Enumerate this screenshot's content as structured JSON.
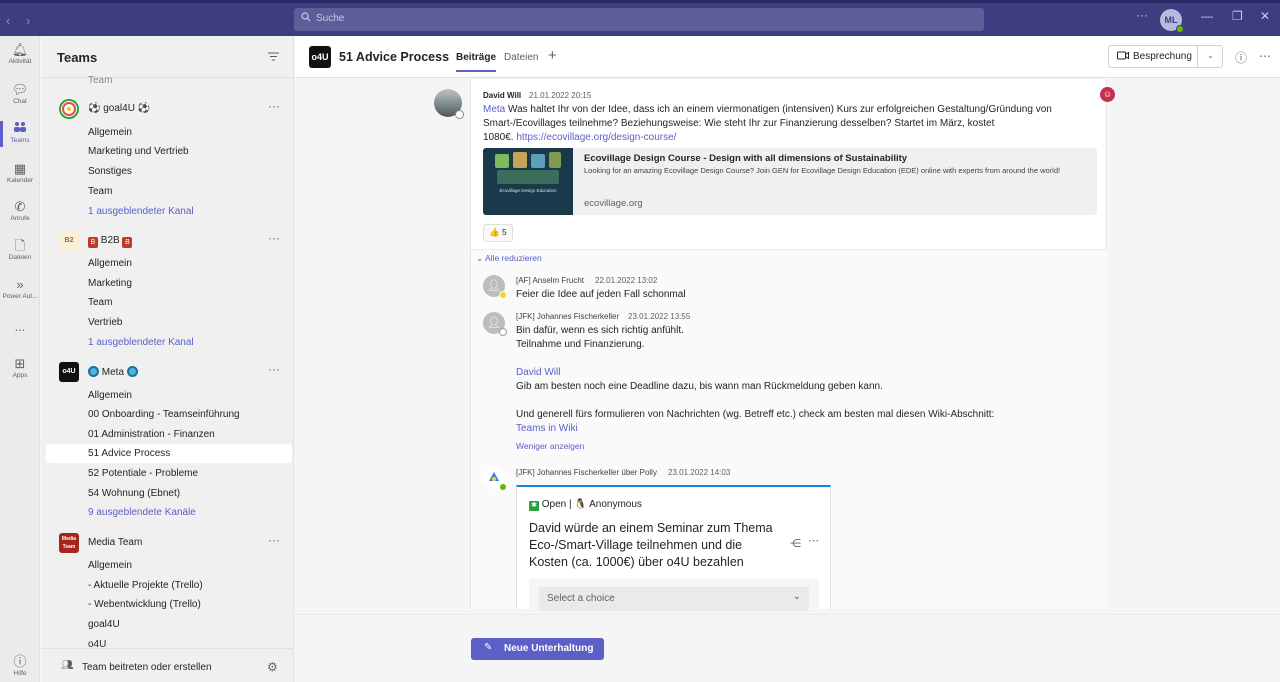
{
  "titlebar": {
    "search_placeholder": "Suche",
    "more": "···",
    "user_initials": "ML"
  },
  "rail": {
    "items": [
      {
        "icon": "bell-icon",
        "label": "Aktivität"
      },
      {
        "icon": "chat-icon",
        "label": "Chat"
      },
      {
        "icon": "teams-icon",
        "label": "Teams"
      },
      {
        "icon": "calendar-icon",
        "label": "Kalender"
      },
      {
        "icon": "phone-icon",
        "label": "Anrufe"
      },
      {
        "icon": "file-icon",
        "label": "Dateien"
      },
      {
        "icon": "power-automate-icon",
        "label": "Power Aut..."
      },
      {
        "icon": "more-icon",
        "label": "..."
      },
      {
        "icon": "apps-icon",
        "label": "Apps"
      },
      {
        "icon": "help-icon",
        "label": "Hilfe"
      }
    ]
  },
  "teams": {
    "header": "Teams",
    "partial_top": "Team",
    "groups": [
      {
        "name": "goal4U",
        "logo_text": "",
        "channels": [
          "Allgemein",
          "Marketing und Vertrieb",
          "Sonstiges",
          "Team"
        ],
        "hidden": "1 ausgeblendeter Kanal"
      },
      {
        "name": "B2B",
        "logo_text": "B2",
        "badge": "B",
        "channels": [
          "Allgemein",
          "Marketing",
          "Team",
          "Vertrieb"
        ],
        "hidden": "1 ausgeblendeter Kanal"
      },
      {
        "name": "Meta",
        "logo_text": "o4U",
        "channels": [
          "Allgemein",
          "00 Onboarding - Teamseinführung",
          "01 Administration - Finanzen",
          "51 Advice Process",
          "52 Potentiale - Probleme",
          "54 Wohnung (Ebnet)"
        ],
        "hidden": "9 ausgeblendete Kanäle"
      },
      {
        "name": "Media Team",
        "logo_text": "Media Team",
        "channels": [
          "Allgemein",
          "- Aktuelle Projekte (Trello)",
          "- Webentwicklung (Trello)",
          "goal4U",
          "o4U"
        ]
      }
    ],
    "more": "···",
    "footer": "Team beitreten oder erstellen"
  },
  "channel": {
    "logo_text": "o4U",
    "title": "51 Advice Process",
    "tabs": [
      "Beiträge",
      "Dateien"
    ],
    "add_tab": "+",
    "meeting_label": "Besprechung"
  },
  "post": {
    "author": "David Will",
    "time": "21.01.2022 20:15",
    "mention": "Meta",
    "text_line1": " Was haltet Ihr von der Idee, dass ich an einem viermonatigen (intensiven) Kurs zur erfolgreichen Gestaltung/Gründung von",
    "text_line2": "Smart-/Ecovillages teilnehme? Beziehungsweise: Wie steht Ihr zur Finanzierung desselben? Startet im März, kostet",
    "text_line3_pre": "1080€. ",
    "url": "https://ecovillage.org/design-course/",
    "link_card": {
      "title": "Ecovillage Design Course - Design with all dimensions of Sustainability",
      "description": "Looking for an amazing Ecovillage Design Course? Join GEN for Ecovillage Design Education (EDE) online with experts from around the world!",
      "domain": "ecovillage.org",
      "thumb_caption": "Ecovillage Design Education"
    },
    "reaction": {
      "emoji": "👍",
      "count": "5"
    },
    "collapse_label": "Alle reduzieren"
  },
  "replies": [
    {
      "author": "[AF] Anselm Frucht",
      "time": "22.01.2022 13:02",
      "lines": [
        "Feier die Idee auf jeden Fall schonmal"
      ],
      "status_color": "#f8d22a"
    },
    {
      "author": "[JFK] Johannes Fischerkeller",
      "time": "23.01.2022 13:55",
      "lines": [
        "Bin dafür, wenn es sich richtig anfühlt.",
        "Teilnahme und Finanzierung."
      ],
      "mention": "David Will",
      "line3": "Gib am besten noch eine Deadline dazu, bis wann man Rückmeldung geben kann.",
      "line4": "Und generell fürs formulieren von Nachrichten (wg. Betreff etc.) check am besten mal diesen Wiki-Abschnitt:",
      "wiki_link": "Teams in Wiki",
      "less": "Weniger anzeigen",
      "status_color": "#ffffff"
    },
    {
      "author": "[JFK] Johannes Fischerkeller über Polly",
      "time": "23.01.2022 14:03"
    }
  ],
  "poll": {
    "status_open": "Open",
    "status_anon": "Anonymous",
    "question": "David würde an einem Seminar zum Thema Eco-/Smart-Village teilnehmen und die Kosten (ca. 1000€) über o4U bezahlen",
    "select_placeholder": "Select a choice"
  },
  "new_conversation": "Neue Unterhaltung",
  "colors": {
    "accent": "#5b5fc7",
    "titlebar": "#3d3e7f"
  }
}
